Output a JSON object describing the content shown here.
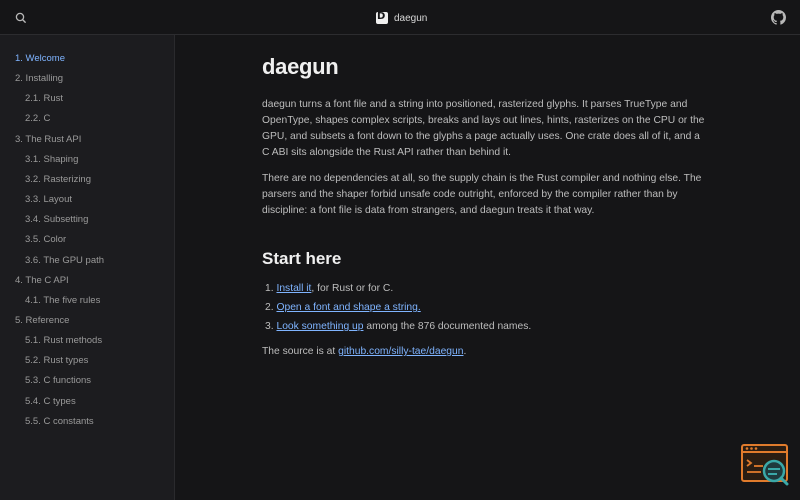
{
  "header": {
    "brand_name": "daegun"
  },
  "sidebar": {
    "items": [
      {
        "label": "1. Welcome",
        "level": 1,
        "active": true
      },
      {
        "label": "2. Installing",
        "level": 1,
        "active": false
      },
      {
        "label": "2.1. Rust",
        "level": 2,
        "active": false
      },
      {
        "label": "2.2. C",
        "level": 2,
        "active": false
      },
      {
        "label": "3. The Rust API",
        "level": 1,
        "active": false
      },
      {
        "label": "3.1. Shaping",
        "level": 2,
        "active": false
      },
      {
        "label": "3.2. Rasterizing",
        "level": 2,
        "active": false
      },
      {
        "label": "3.3. Layout",
        "level": 2,
        "active": false
      },
      {
        "label": "3.4. Subsetting",
        "level": 2,
        "active": false
      },
      {
        "label": "3.5. Color",
        "level": 2,
        "active": false
      },
      {
        "label": "3.6. The GPU path",
        "level": 2,
        "active": false
      },
      {
        "label": "4. The C API",
        "level": 1,
        "active": false
      },
      {
        "label": "4.1. The five rules",
        "level": 2,
        "active": false
      },
      {
        "label": "5. Reference",
        "level": 1,
        "active": false
      },
      {
        "label": "5.1. Rust methods",
        "level": 2,
        "active": false
      },
      {
        "label": "5.2. Rust types",
        "level": 2,
        "active": false
      },
      {
        "label": "5.3. C functions",
        "level": 2,
        "active": false
      },
      {
        "label": "5.4. C types",
        "level": 2,
        "active": false
      },
      {
        "label": "5.5. C constants",
        "level": 2,
        "active": false
      }
    ]
  },
  "main": {
    "title": "daegun",
    "paragraph_1": "daegun turns a font file and a string into positioned, rasterized glyphs. It parses TrueType and OpenType, shapes complex scripts, breaks and lays out lines, hints, rasterizes on the CPU or the GPU, and subsets a font down to the glyphs a page actually uses. One crate does all of it, and a C ABI sits alongside the Rust API rather than behind it.",
    "paragraph_2": "There are no dependencies at all, so the supply chain is the Rust compiler and nothing else. The parsers and the shaper forbid unsafe code outright, enforced by the compiler rather than by discipline: a font file is data from strangers, and daegun treats it that way.",
    "section_title": "Start here",
    "steps": [
      {
        "number": "1.",
        "link": "Install it",
        "rest": ", for Rust or for C."
      },
      {
        "number": "2.",
        "link": "Open a font and shape a string.",
        "rest": ""
      },
      {
        "number": "3.",
        "link": "Look something up",
        "rest": " among the 876 documented names."
      }
    ],
    "source_prefix": "The source is at ",
    "source_link": "github.com/silly-tae/daegun",
    "source_suffix": "."
  },
  "colors": {
    "background": "#151517",
    "sidebar_background": "#1c1c1f",
    "link": "#7fb4ff",
    "widget_accent": "#e07b2c",
    "widget_circle": "#3aa8a8"
  },
  "icons": {
    "search": "search-icon",
    "github": "github-icon",
    "brand": "daegun-logo-icon",
    "widget": "terminal-search-icon"
  }
}
